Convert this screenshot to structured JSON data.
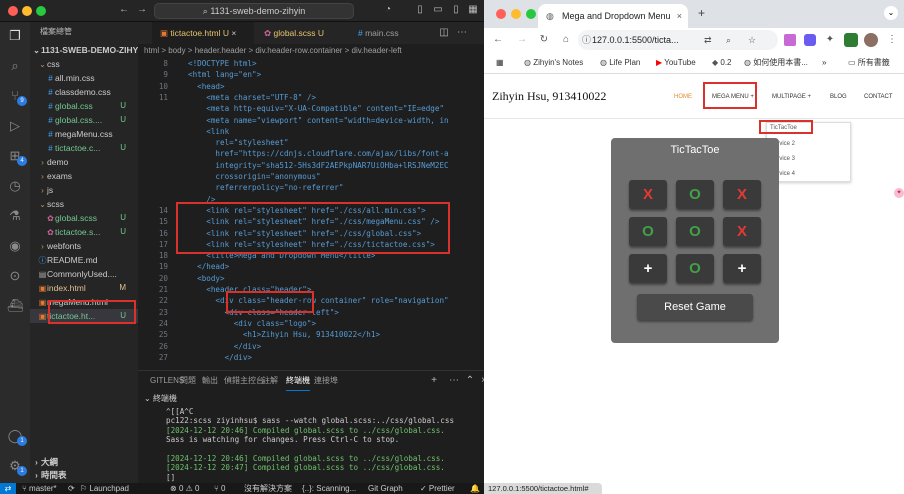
{
  "vscode": {
    "title": "1131-sweb-demo-zihyin",
    "explorer_title": "檔案總管",
    "project": "1131-SWEB-DEMO-ZIHYIN",
    "tree": [
      {
        "label": "css",
        "kind": "folder",
        "depth": 1
      },
      {
        "label": "all.min.css",
        "kind": "css",
        "depth": 2,
        "status": ""
      },
      {
        "label": "classdemo.css",
        "kind": "css",
        "depth": 2,
        "status": ""
      },
      {
        "label": "global.css",
        "kind": "css",
        "depth": 2,
        "status": "U"
      },
      {
        "label": "global.css....",
        "kind": "css",
        "depth": 2,
        "status": "U"
      },
      {
        "label": "megaMenu.css",
        "kind": "css",
        "depth": 2,
        "status": ""
      },
      {
        "label": "tictactoe.c...",
        "kind": "css",
        "depth": 2,
        "status": "U"
      },
      {
        "label": "demo",
        "kind": "folder",
        "depth": 1
      },
      {
        "label": "exams",
        "kind": "folder",
        "depth": 1
      },
      {
        "label": "js",
        "kind": "folder",
        "depth": 1
      },
      {
        "label": "scss",
        "kind": "folder",
        "depth": 1
      },
      {
        "label": "global.scss",
        "kind": "scss",
        "depth": 2,
        "status": "U"
      },
      {
        "label": "tictactoe.s...",
        "kind": "scss",
        "depth": 2,
        "status": "U"
      },
      {
        "label": "webfonts",
        "kind": "folder",
        "depth": 1
      },
      {
        "label": "README.md",
        "kind": "md",
        "depth": 1,
        "status": ""
      },
      {
        "label": "CommonlyUsed....",
        "kind": "file",
        "depth": 1,
        "status": ""
      },
      {
        "label": "index.html",
        "kind": "html",
        "depth": 1,
        "status": "M"
      },
      {
        "label": "megaMenu.html",
        "kind": "html",
        "depth": 1,
        "status": ""
      },
      {
        "label": "tictactoe.ht...",
        "kind": "html",
        "depth": 1,
        "status": "U"
      }
    ],
    "outline": "大綱",
    "timeline": "時間表",
    "tabs": [
      {
        "label": "tictactoe.html",
        "status": "U"
      },
      {
        "label": "global.scss",
        "status": "U"
      },
      {
        "label": "main.css",
        "status": ""
      }
    ],
    "breadcrumb": "html > body > header.header > div.header-row.container > div.header-left",
    "code": [
      {
        "n": "8",
        "t": "<!DOCTYPE html>"
      },
      {
        "n": "9",
        "t": "<html lang=\"en\">"
      },
      {
        "n": "10",
        "t": "  <head>"
      },
      {
        "n": "11",
        "t": "    <meta charset=\"UTF-8\" />"
      },
      {
        "n": "",
        "t": "    <meta http-equiv=\"X-UA-Compatible\" content=\"IE=edge\""
      },
      {
        "n": "",
        "t": "    <meta name=\"viewport\" content=\"width=device-width, in"
      },
      {
        "n": "",
        "t": "    <link"
      },
      {
        "n": "",
        "t": "      rel=\"stylesheet\""
      },
      {
        "n": "",
        "t": "      href=\"https://cdnjs.cloudflare.com/ajax/libs/font-a"
      },
      {
        "n": "",
        "t": "      integrity=\"sha512-5Hs3dF2AEPkpNAR7UiOHba+lRSJNeM2EC"
      },
      {
        "n": "",
        "t": "      crossorigin=\"anonymous\""
      },
      {
        "n": "",
        "t": "      referrerpolicy=\"no-referrer\""
      },
      {
        "n": "",
        "t": "    />"
      },
      {
        "n": "14",
        "t": "    <link rel=\"stylesheet\" href=\"./css/all.min.css\">"
      },
      {
        "n": "15",
        "t": "    <link rel=\"stylesheet\" href=\"./css/megaMenu.css\" />"
      },
      {
        "n": "16",
        "t": "    <link rel=\"stylesheet\" href=\"./css/global.css\">"
      },
      {
        "n": "17",
        "t": "    <link rel=\"stylesheet\" href=\"./css/tictactoe.css\">"
      },
      {
        "n": "18",
        "t": "    <title>Mega and Dropdown Menu</title>"
      },
      {
        "n": "19",
        "t": "  </head>"
      },
      {
        "n": "20",
        "t": "  <body>"
      },
      {
        "n": "21",
        "t": "    <header class=\"header\">"
      },
      {
        "n": "22",
        "t": "      <div class=\"header-row container\" role=\"navigation\""
      },
      {
        "n": "23",
        "t": "        <div class=\"header-left\">"
      },
      {
        "n": "24",
        "t": "          <div class=\"logo\">"
      },
      {
        "n": "25",
        "t": "            <h1>Zihyin Hsu, 913410022</h1>"
      },
      {
        "n": "26",
        "t": "          </div>"
      },
      {
        "n": "27",
        "t": "        </div>"
      }
    ],
    "panel_tabs": [
      "GITLENS",
      "問題",
      "輸出",
      "偵錯主控台",
      "註解",
      "終端機",
      "連接埠"
    ],
    "terminal_label": "終端機",
    "terminal": [
      "^[[A^C",
      "pc122:scss ziyinhsu$ sass --watch global.scss:../css/global.css",
      "[2024-12-12 20:46] Compiled global.scss to ../css/global.css.",
      "Sass is watching for changes. Press Ctrl-C to stop.",
      "",
      "[2024-12-12 20:46] Compiled global.scss to ../css/global.css.",
      "[2024-12-12 20:47] Compiled global.scss to ../css/global.css.",
      "[]"
    ],
    "status": {
      "branch": "master*",
      "sync": "⟳",
      "errors": "0",
      "warnings": "0",
      "launchpad": "Launchpad",
      "ports": "0",
      "issues": "沒有解決方案",
      "scanning": "{..}: Scanning...",
      "git": "Git Graph",
      "prettier": "✓ Prettier"
    }
  },
  "browser": {
    "tab_title": "Mega and Dropdown Menu",
    "url": "127.0.0.1:5500/tictactoe.html",
    "url_display": "127.0.0.1:5500/tictа...",
    "bookmarks": [
      "Zihyin's Notes",
      "Life Plan",
      "YouTube",
      "0.2",
      "如何使用本書...",
      "所有書籤"
    ],
    "site_title": "Zihyin Hsu, 913410022",
    "nav": [
      "HOME",
      "MEGA MENU +",
      "MULTIPAGE +",
      "BLOG",
      "CONTACT"
    ],
    "dropdown": [
      "TicTacToe",
      "Service 2",
      "Service 3",
      "Service 4"
    ],
    "game_title": "TicTacToe",
    "board": [
      "X",
      "O",
      "X",
      "O",
      "O",
      "X",
      "+",
      "O",
      "+"
    ],
    "reset": "Reset Game",
    "status_url": "127.0.0.1:5500/tictactoe.html#",
    "colors": {
      "x": "#e53935",
      "o": "#43a047",
      "plus": "#ffffff",
      "accent": "#d9312b"
    }
  }
}
